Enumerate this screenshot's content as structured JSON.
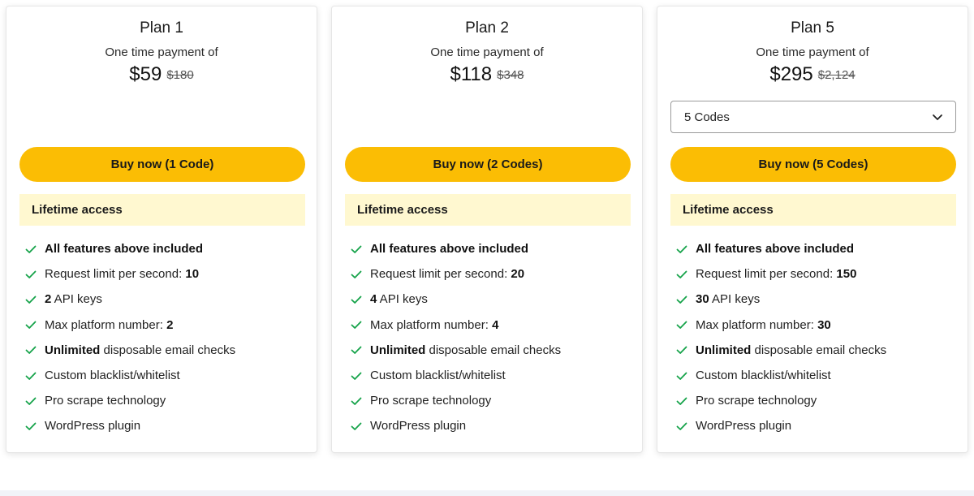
{
  "accent_color": "#fbbd04",
  "access_bg_color": "#fff8d0",
  "check_color": "#16a34a",
  "plans": [
    {
      "title": "Plan 1",
      "payment_label": "One time payment of",
      "price": "$59",
      "old_price": "$180",
      "select_value": null,
      "buy_label": "Buy now (1 Code)",
      "access_label": "Lifetime access",
      "features": [
        {
          "bold": "All features above included",
          "text": ""
        },
        {
          "text": "Request limit per second: ",
          "bold": "10"
        },
        {
          "bold": "2",
          "text": " API keys"
        },
        {
          "text": "Max platform number: ",
          "bold": "2"
        },
        {
          "bold": "Unlimited",
          "text": " disposable email checks"
        },
        {
          "text": "Custom blacklist/whitelist",
          "bold": ""
        },
        {
          "text": "Pro scrape technology",
          "bold": ""
        },
        {
          "text": "WordPress plugin",
          "bold": ""
        }
      ]
    },
    {
      "title": "Plan 2",
      "payment_label": "One time payment of",
      "price": "$118",
      "old_price": "$348",
      "select_value": null,
      "buy_label": "Buy now (2 Codes)",
      "access_label": "Lifetime access",
      "features": [
        {
          "bold": "All features above included",
          "text": ""
        },
        {
          "text": "Request limit per second: ",
          "bold": "20"
        },
        {
          "bold": "4",
          "text": " API keys"
        },
        {
          "text": "Max platform number: ",
          "bold": "4"
        },
        {
          "bold": "Unlimited",
          "text": " disposable email checks"
        },
        {
          "text": "Custom blacklist/whitelist",
          "bold": ""
        },
        {
          "text": "Pro scrape technology",
          "bold": ""
        },
        {
          "text": "WordPress plugin",
          "bold": ""
        }
      ]
    },
    {
      "title": "Plan 5",
      "payment_label": "One time payment of",
      "price": "$295",
      "old_price": "$2,124",
      "select_value": "5 Codes",
      "buy_label": "Buy now (5 Codes)",
      "access_label": "Lifetime access",
      "features": [
        {
          "bold": "All features above included",
          "text": ""
        },
        {
          "text": "Request limit per second: ",
          "bold": "150"
        },
        {
          "bold": "30",
          "text": " API keys"
        },
        {
          "text": "Max platform number: ",
          "bold": "30"
        },
        {
          "bold": "Unlimited",
          "text": " disposable email checks"
        },
        {
          "text": "Custom blacklist/whitelist",
          "bold": ""
        },
        {
          "text": "Pro scrape technology",
          "bold": ""
        },
        {
          "text": "WordPress plugin",
          "bold": ""
        }
      ]
    }
  ]
}
